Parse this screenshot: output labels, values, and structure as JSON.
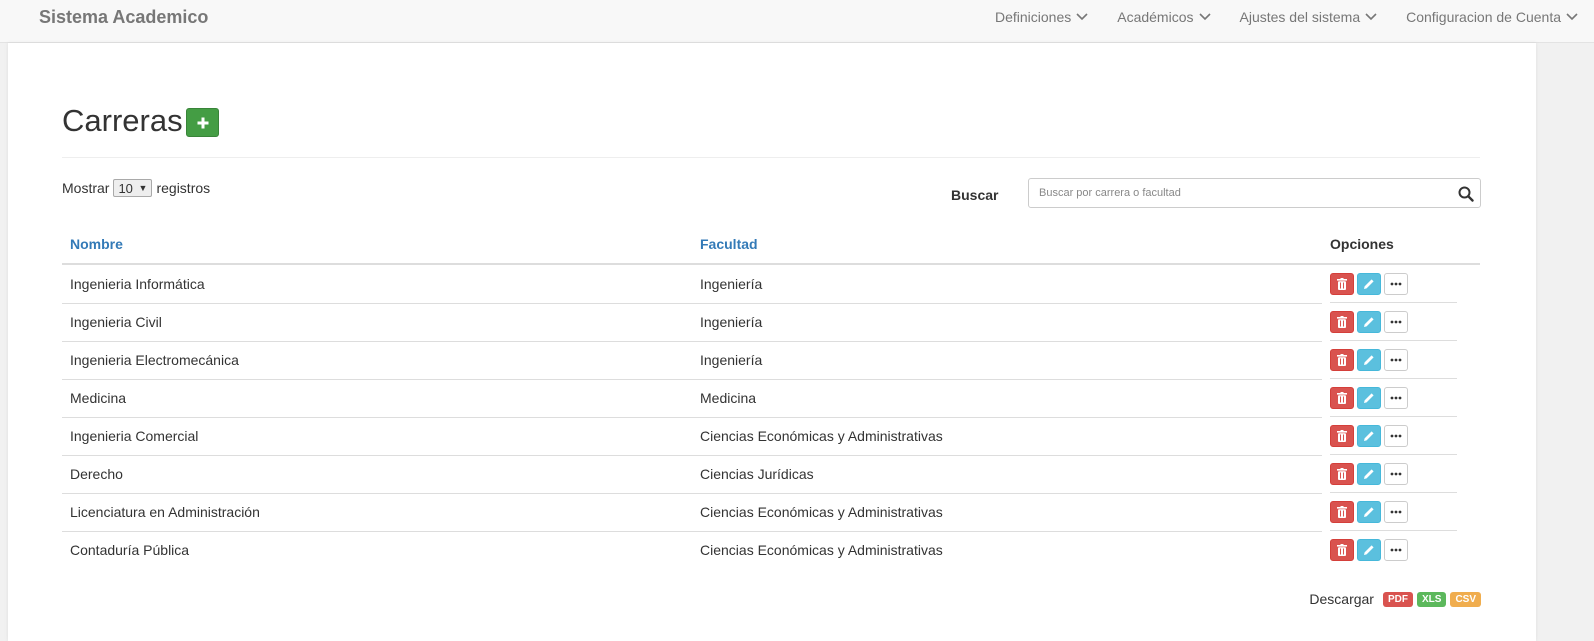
{
  "app": {
    "brand": "Sistema Academico"
  },
  "nav": {
    "items": [
      {
        "label": "Definiciones"
      },
      {
        "label": "Académicos"
      },
      {
        "label": "Ajustes del sistema"
      },
      {
        "label": "Configuracion de Cuenta"
      }
    ]
  },
  "page": {
    "title": "Carreras",
    "add_icon": "plus-icon"
  },
  "length": {
    "prefix": "Mostrar",
    "value": "10",
    "suffix": "registros"
  },
  "search": {
    "label": "Buscar",
    "placeholder": "Buscar por carrera o facultad",
    "value": "",
    "icon": "search-icon"
  },
  "table": {
    "headers": {
      "nombre": "Nombre",
      "facultad": "Facultad",
      "opciones": "Opciones"
    },
    "rows": [
      {
        "nombre": "Ingenieria Informática",
        "facultad": "Ingeniería"
      },
      {
        "nombre": "Ingenieria Civil",
        "facultad": "Ingeniería"
      },
      {
        "nombre": "Ingenieria Electromecánica",
        "facultad": "Ingeniería"
      },
      {
        "nombre": "Medicina",
        "facultad": "Medicina"
      },
      {
        "nombre": "Ingenieria Comercial",
        "facultad": "Ciencias Económicas y Administrativas"
      },
      {
        "nombre": "Derecho",
        "facultad": "Ciencias Jurídicas"
      },
      {
        "nombre": "Licenciatura en Administración",
        "facultad": "Ciencias Económicas y Administrativas"
      },
      {
        "nombre": "Contaduría Pública",
        "facultad": "Ciencias Económicas y Administrativas"
      }
    ],
    "row_actions": [
      "trash-icon",
      "pencil-icon",
      "ellipsis-icon"
    ]
  },
  "download": {
    "label": "Descargar",
    "formats": [
      {
        "label": "PDF",
        "color": "#d9534f"
      },
      {
        "label": "XLS",
        "color": "#5cb85c"
      },
      {
        "label": "CSV",
        "color": "#f0ad4e"
      }
    ]
  },
  "colors": {
    "link": "#337ab7",
    "success": "#449d44",
    "danger": "#d9534f",
    "info": "#5bc0de"
  }
}
